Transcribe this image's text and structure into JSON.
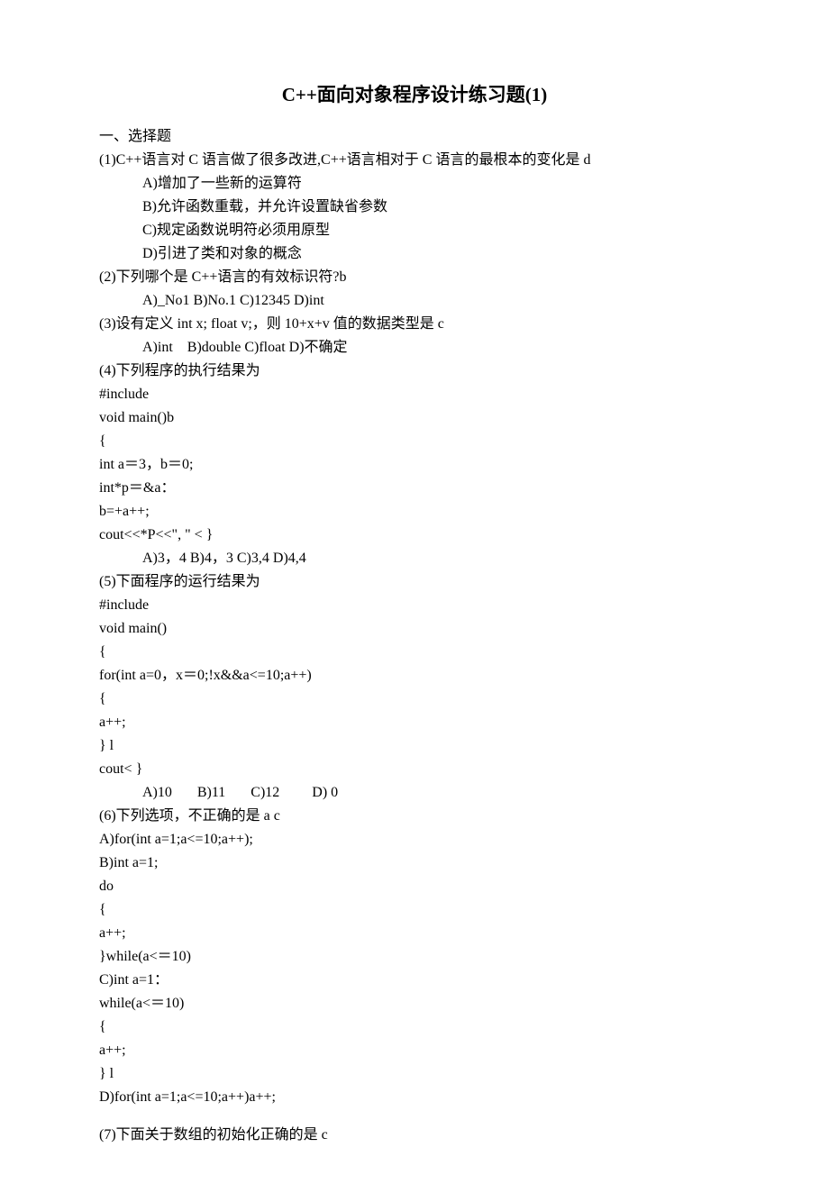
{
  "title": "C++面向对象程序设计练习题(1)",
  "section1_heading": "一、选择题",
  "q1": {
    "stem": "(1)C++语言对 C 语言做了很多改进,C++语言相对于 C 语言的最根本的变化是 d",
    "optA": "A)增加了一些新的运算符",
    "optB": "B)允许函数重载，并允许设置缺省参数",
    "optC": "C)规定函数说明符必须用原型",
    "optD": "D)引进了类和对象的概念"
  },
  "q2": {
    "stem": "(2)下列哪个是 C++语言的有效标识符?b",
    "opts": "A)_No1 B)No.1 C)12345 D)int"
  },
  "q3": {
    "stem": "(3)设有定义 int x; float v;，则 10+x+v 值的数据类型是 c",
    "opts": "A)int    B)double C)float D)不确定"
  },
  "q4": {
    "stem": "(4)下列程序的执行结果为",
    "c1": "#include",
    "c2": "void main()b",
    "c3": "{",
    "c4": "int a＝3，b＝0;",
    "c5": "int*p＝&a：",
    "c6": "b=+a++;",
    "c7": "cout<<*P<<\", \" < }",
    "opts": "A)3，4 B)4，3 C)3,4 D)4,4"
  },
  "q5": {
    "stem": "(5)下面程序的运行结果为",
    "c1": "#include",
    "c2": "void main()",
    "c3": "{",
    "c4": "for(int a=0，x＝0;!x&&a<=10;a++)",
    "c5": "{",
    "c6": "a++;",
    "c7": "} l",
    "c8": "cout< }",
    "opts": "A)10       B)11       C)12         D) 0"
  },
  "q6": {
    "stem": "(6)下列选项，不正确的是 a c",
    "a1": "A)for(int a=1;a<=10;a++);",
    "b1": "B)int a=1;",
    "b2": "do",
    "b3": "{",
    "b4": "a++;",
    "b5": "}while(a<＝10)",
    "c1": "C)int a=1：",
    "c2": "while(a<＝10)",
    "c3": "{",
    "c4": "a++;",
    "c5": "} l",
    "d1": "D)for(int a=1;a<=10;a++)a++;"
  },
  "q7": {
    "stem": "(7)下面关于数组的初始化正确的是 c"
  }
}
